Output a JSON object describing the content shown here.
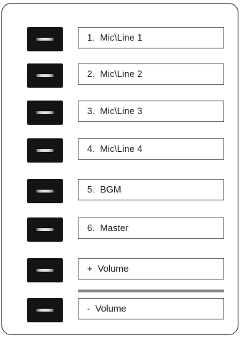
{
  "channels": [
    {
      "label": "1.  Mic\\Line 1"
    },
    {
      "label": "2.  Mic\\Line 2"
    },
    {
      "label": "3.  Mic\\Line 3"
    },
    {
      "label": "4.  Mic\\Line 4"
    },
    {
      "label": "5.  BGM"
    },
    {
      "label": "6.  Master"
    },
    {
      "label": "+  Volume"
    },
    {
      "label": "-  Volume"
    }
  ]
}
